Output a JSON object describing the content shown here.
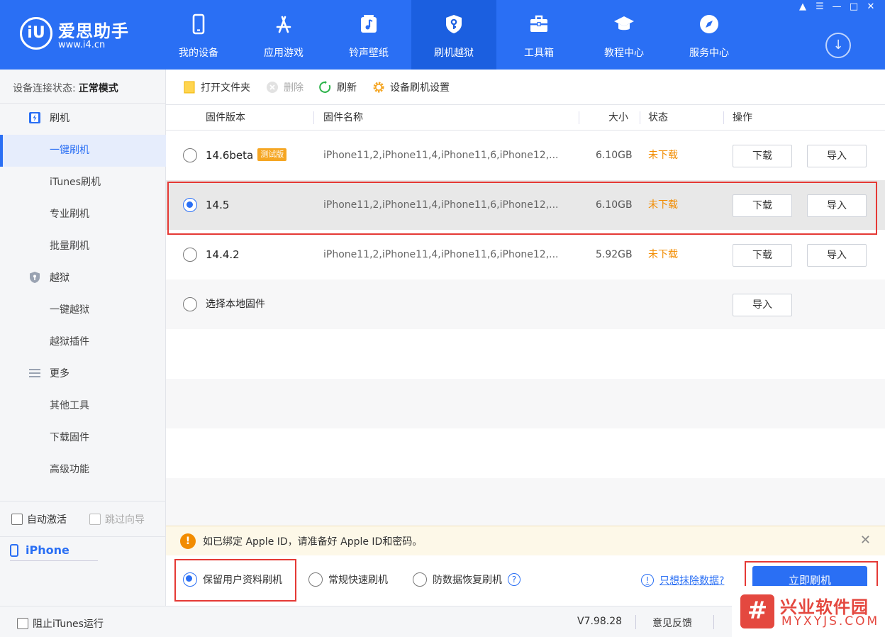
{
  "app": {
    "logo_mark": "iU",
    "logo_name": "爱思助手",
    "logo_url": "www.i4.cn",
    "accent_color": "#2a6ff4"
  },
  "nav": [
    {
      "label": "我的设备",
      "icon": "phone-icon"
    },
    {
      "label": "应用游戏",
      "icon": "app-store-icon"
    },
    {
      "label": "铃声壁纸",
      "icon": "music-icon"
    },
    {
      "label": "刷机越狱",
      "icon": "shield-key-icon",
      "active": true
    },
    {
      "label": "工具箱",
      "icon": "toolbox-icon"
    },
    {
      "label": "教程中心",
      "icon": "graduation-cap-icon"
    },
    {
      "label": "服务中心",
      "icon": "compass-icon"
    }
  ],
  "window_controls": [
    "shirt-icon",
    "menu-icon",
    "minimize-icon",
    "maximize-icon",
    "close-icon"
  ],
  "sidebar": {
    "status_label": "设备连接状态:",
    "status_value": "正常模式",
    "groups": [
      {
        "label": "刷机",
        "icon": "flash-icon",
        "items": [
          "一键刷机",
          "iTunes刷机",
          "专业刷机",
          "批量刷机"
        ]
      },
      {
        "label": "越狱",
        "icon": "shield-icon",
        "items": [
          "一键越狱",
          "越狱插件"
        ]
      },
      {
        "label": "更多",
        "icon": "list-icon",
        "items": [
          "其他工具",
          "下载固件",
          "高级功能"
        ]
      }
    ],
    "active_item": "一键刷机",
    "auto_activate": "自动激活",
    "skip_guide": "跳过向导",
    "device_name": "iPhone"
  },
  "toolbar": {
    "open_folder": "打开文件夹",
    "delete": "删除",
    "refresh": "刷新",
    "settings": "设备刷机设置"
  },
  "table": {
    "headers": {
      "version": "固件版本",
      "name": "固件名称",
      "size": "大小",
      "status": "状态",
      "action": "操作"
    },
    "rows": [
      {
        "version": "14.6beta",
        "badge": "测试版",
        "name": "iPhone11,2,iPhone11,4,iPhone11,6,iPhone12,...",
        "size": "6.10GB",
        "status": "未下载",
        "download": "下载",
        "import": "导入",
        "selected": false
      },
      {
        "version": "14.5",
        "name": "iPhone11,2,iPhone11,4,iPhone11,6,iPhone12,...",
        "size": "6.10GB",
        "status": "未下载",
        "download": "下载",
        "import": "导入",
        "selected": true
      },
      {
        "version": "14.4.2",
        "name": "iPhone11,2,iPhone11,4,iPhone11,6,iPhone12,...",
        "size": "5.92GB",
        "status": "未下载",
        "download": "下载",
        "import": "导入",
        "selected": false
      }
    ],
    "local_firmware": {
      "label": "选择本地固件",
      "import": "导入"
    }
  },
  "notice": {
    "text": "如已绑定 Apple ID，请准备好 Apple ID和密码。"
  },
  "flash_options": {
    "keep_data": "保留用户资料刷机",
    "quick": "常规快速刷机",
    "anti_recovery": "防数据恢复刷机",
    "selected": "keep_data",
    "erase_link": "只想抹除数据?",
    "flash_button": "立即刷机"
  },
  "statusbar": {
    "block_itunes": "阻止iTunes运行",
    "version": "V7.98.28",
    "feedback": "意见反馈"
  },
  "watermark": {
    "badge": "#",
    "cn": "兴业软件园",
    "en": "MYXYJS.COM"
  }
}
